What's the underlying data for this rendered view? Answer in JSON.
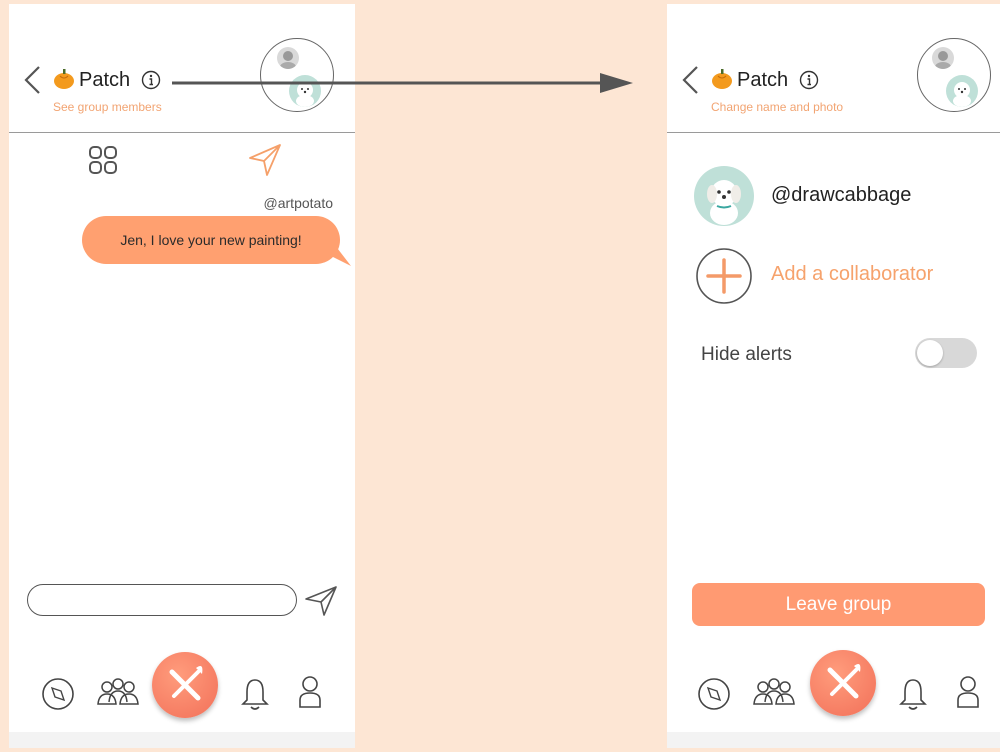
{
  "colors": {
    "background": "#fde6d4",
    "accent": "#ffa070",
    "subtitle": "#f2a472",
    "fab": "#f27059",
    "toggle_off": "#d8d8d8"
  },
  "left_screen": {
    "header": {
      "title": "Patch",
      "subtitle": "See group members"
    },
    "toolbar_icons": [
      "grid-icon",
      "send-icon"
    ],
    "message": {
      "author": "@artpotato",
      "text": "Jen, I love your new painting!"
    },
    "composer": {
      "placeholder": ""
    },
    "nav_icons": [
      "compass-icon",
      "group-icon",
      "pencil-brush-icon",
      "bell-icon",
      "profile-icon"
    ]
  },
  "right_screen": {
    "header": {
      "title": "Patch",
      "subtitle": "Change name and photo"
    },
    "member": {
      "handle": "@drawcabbage"
    },
    "add_collaborator": {
      "label": "Add a collaborator"
    },
    "hide_alerts": {
      "label": "Hide alerts",
      "enabled": false
    },
    "leave_button": {
      "label": "Leave group"
    },
    "nav_icons": [
      "compass-icon",
      "group-icon",
      "pencil-brush-icon",
      "bell-icon",
      "profile-icon"
    ]
  }
}
